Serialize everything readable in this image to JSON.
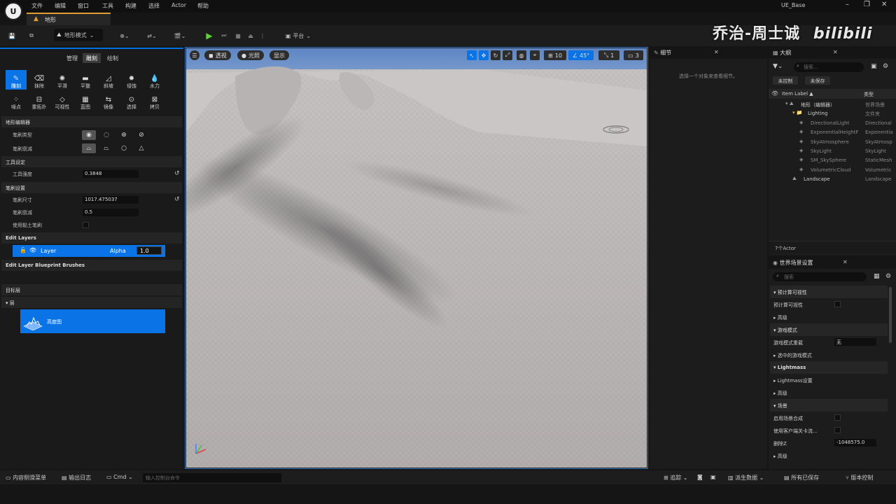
{
  "app": {
    "project_name": "UE_Base",
    "logo_text": "U"
  },
  "menu": [
    "文件",
    "编辑",
    "窗口",
    "工具",
    "构建",
    "选择",
    "Actor",
    "帮助"
  ],
  "map_tab": "地形",
  "toolbar": {
    "mode_label": "地形模式",
    "platform_label": "平台"
  },
  "watermark": {
    "text": "乔治-周士诚",
    "brand": "bilibili"
  },
  "landscape_panel": {
    "tabs": [
      "管理",
      "雕刻",
      "绘制"
    ],
    "selected_tab": "雕刻",
    "tools": [
      "雕刻",
      "抹除",
      "平滑",
      "平整",
      "斜坡",
      "侵蚀",
      "水力",
      "噪点",
      "重拓扑",
      "可视性",
      "蓝图",
      "镜像",
      "选择",
      "拷贝"
    ],
    "selected_tool": "雕刻",
    "sections": {
      "editor": "地形编辑器",
      "tool_settings": "工具设定",
      "brush_settings": "笔刷设置",
      "edit_layers": "Edit Layers",
      "blueprint_brushes": "Edit Layer Blueprint Brushes",
      "target_layers": "目标层",
      "layers": "层"
    },
    "props": {
      "brush_type": "笔刷类型",
      "brush_falloff": "笔刷衰减",
      "tool_strength": "工具强度",
      "tool_strength_value": "0.3848",
      "brush_size": "笔刷尺寸",
      "brush_size_value": "1017.475037",
      "brush_falloff_amt": "笔刷衰减",
      "brush_falloff_value": "0.5",
      "use_clay_brush": "使用黏土笔刷"
    },
    "layer": {
      "name": "Layer",
      "alpha_label": "Alpha",
      "alpha_value": "1.0"
    },
    "heightmap_label": "高度图"
  },
  "viewport": {
    "perspective": "透视",
    "lighting": "光照",
    "show": "显示",
    "grid_size": "10",
    "angle": "45°",
    "scale": "1",
    "camera_speed": "3"
  },
  "details": {
    "title": "细节",
    "empty_text": "选择一个对象来查看细节。"
  },
  "outliner": {
    "title": "大纲",
    "search_placeholder": "搜索...",
    "unsaved_btn": "未控制",
    "not_saved_btn": "未保存",
    "col_label": "Item Label ▲",
    "col_type": "类型",
    "rows": [
      {
        "label": "地形（编辑器）",
        "type": "世界场景",
        "indent": 0
      },
      {
        "label": "Lighting",
        "type": "文件夹",
        "indent": 1
      },
      {
        "label": "DirectionalLight",
        "type": "Directional",
        "indent": 2
      },
      {
        "label": "ExponentialHeightF",
        "type": "Exponentia",
        "indent": 2
      },
      {
        "label": "SkyAtmosphere",
        "type": "SkyAtmosp",
        "indent": 2
      },
      {
        "label": "SkyLight",
        "type": "SkyLight",
        "indent": 2
      },
      {
        "label": "SM_SkySphere",
        "type": "StaticMesh",
        "indent": 2
      },
      {
        "label": "VolumetricCloud",
        "type": "Volumetric",
        "indent": 2
      },
      {
        "label": "Landscape",
        "type": "Landscape",
        "indent": 1
      }
    ],
    "count": "7个Actor"
  },
  "world_settings": {
    "title": "世界场景设置",
    "search_placeholder": "搜索",
    "rows": [
      {
        "label": "预计算可视性",
        "kind": "head"
      },
      {
        "label": "预计算可视性",
        "kind": "check"
      },
      {
        "label": "高级",
        "kind": "sub"
      },
      {
        "label": "游戏模式",
        "kind": "head"
      },
      {
        "label": "游戏模式重载",
        "kind": "value",
        "value": "无"
      },
      {
        "label": "选中的游戏模式",
        "kind": "sub"
      },
      {
        "label": "Lightmass",
        "kind": "head"
      },
      {
        "label": "Lightmass设置",
        "kind": "sub"
      },
      {
        "label": "高级",
        "kind": "sub"
      },
      {
        "label": "场景",
        "kind": "head"
      },
      {
        "label": "启用场景合成",
        "kind": "check"
      },
      {
        "label": "使用客户端关卡流...",
        "kind": "check"
      },
      {
        "label": "删除Z",
        "kind": "value",
        "value": "-1048575.0"
      },
      {
        "label": "高级",
        "kind": "sub"
      }
    ]
  },
  "statusbar": {
    "content_drawer": "内容侧滑菜单",
    "output_log": "输出日志",
    "cmd": "Cmd",
    "console_placeholder": "输入控制台命令",
    "trace": "追踪",
    "derived_data": "派生数据",
    "all_saved": "所有已保存",
    "source_control": "版本控制"
  }
}
